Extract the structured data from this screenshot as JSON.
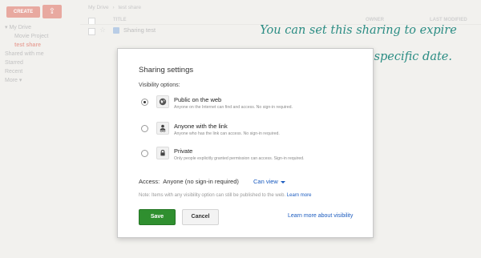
{
  "background_app": {
    "create_label": "CREATE",
    "breadcrumb": [
      "My Drive",
      "›",
      "test share"
    ],
    "columns": {
      "title": "TITLE",
      "owner": "OWNER",
      "last_modified": "LAST MODIFIED"
    },
    "sidebar": {
      "my_drive": "▾ My Drive",
      "items": [
        "Movie Project",
        "test share"
      ],
      "shared": "Shared with me",
      "starred": "Starred",
      "recent": "Recent",
      "more": "More ▾"
    },
    "file_row_title": "Sharing test"
  },
  "annotation": {
    "line1": "You can set this sharing to expire",
    "line2": "automatically at a specific date."
  },
  "dialog": {
    "title": "Sharing settings",
    "visibility_label": "Visibility options:",
    "options": [
      {
        "label": "Public on the web",
        "desc": "Anyone on the Internet can find and access. No sign-in required.",
        "icon": "globe-icon",
        "selected": true
      },
      {
        "label": "Anyone with the link",
        "desc": "Anyone who has the link can access. No sign-in required.",
        "icon": "person-link-icon",
        "selected": false
      },
      {
        "label": "Private",
        "desc": "Only people explicitly granted permission can access. Sign-in required.",
        "icon": "lock-icon",
        "selected": false
      }
    ],
    "access_label": "Access:",
    "access_value": "Anyone (no sign-in required)",
    "can_view": "Can view",
    "note": "Note: Items with any visibility option can still be published to the web.",
    "note_link": "Learn more",
    "save": "Save",
    "cancel": "Cancel",
    "learn_more_visibility": "Learn more about visibility"
  },
  "colors": {
    "accent_red": "#e8a9a0",
    "save_green": "#2f8f2f",
    "link_blue": "#1a5bbf",
    "annotation_teal": "#2a8c83"
  }
}
